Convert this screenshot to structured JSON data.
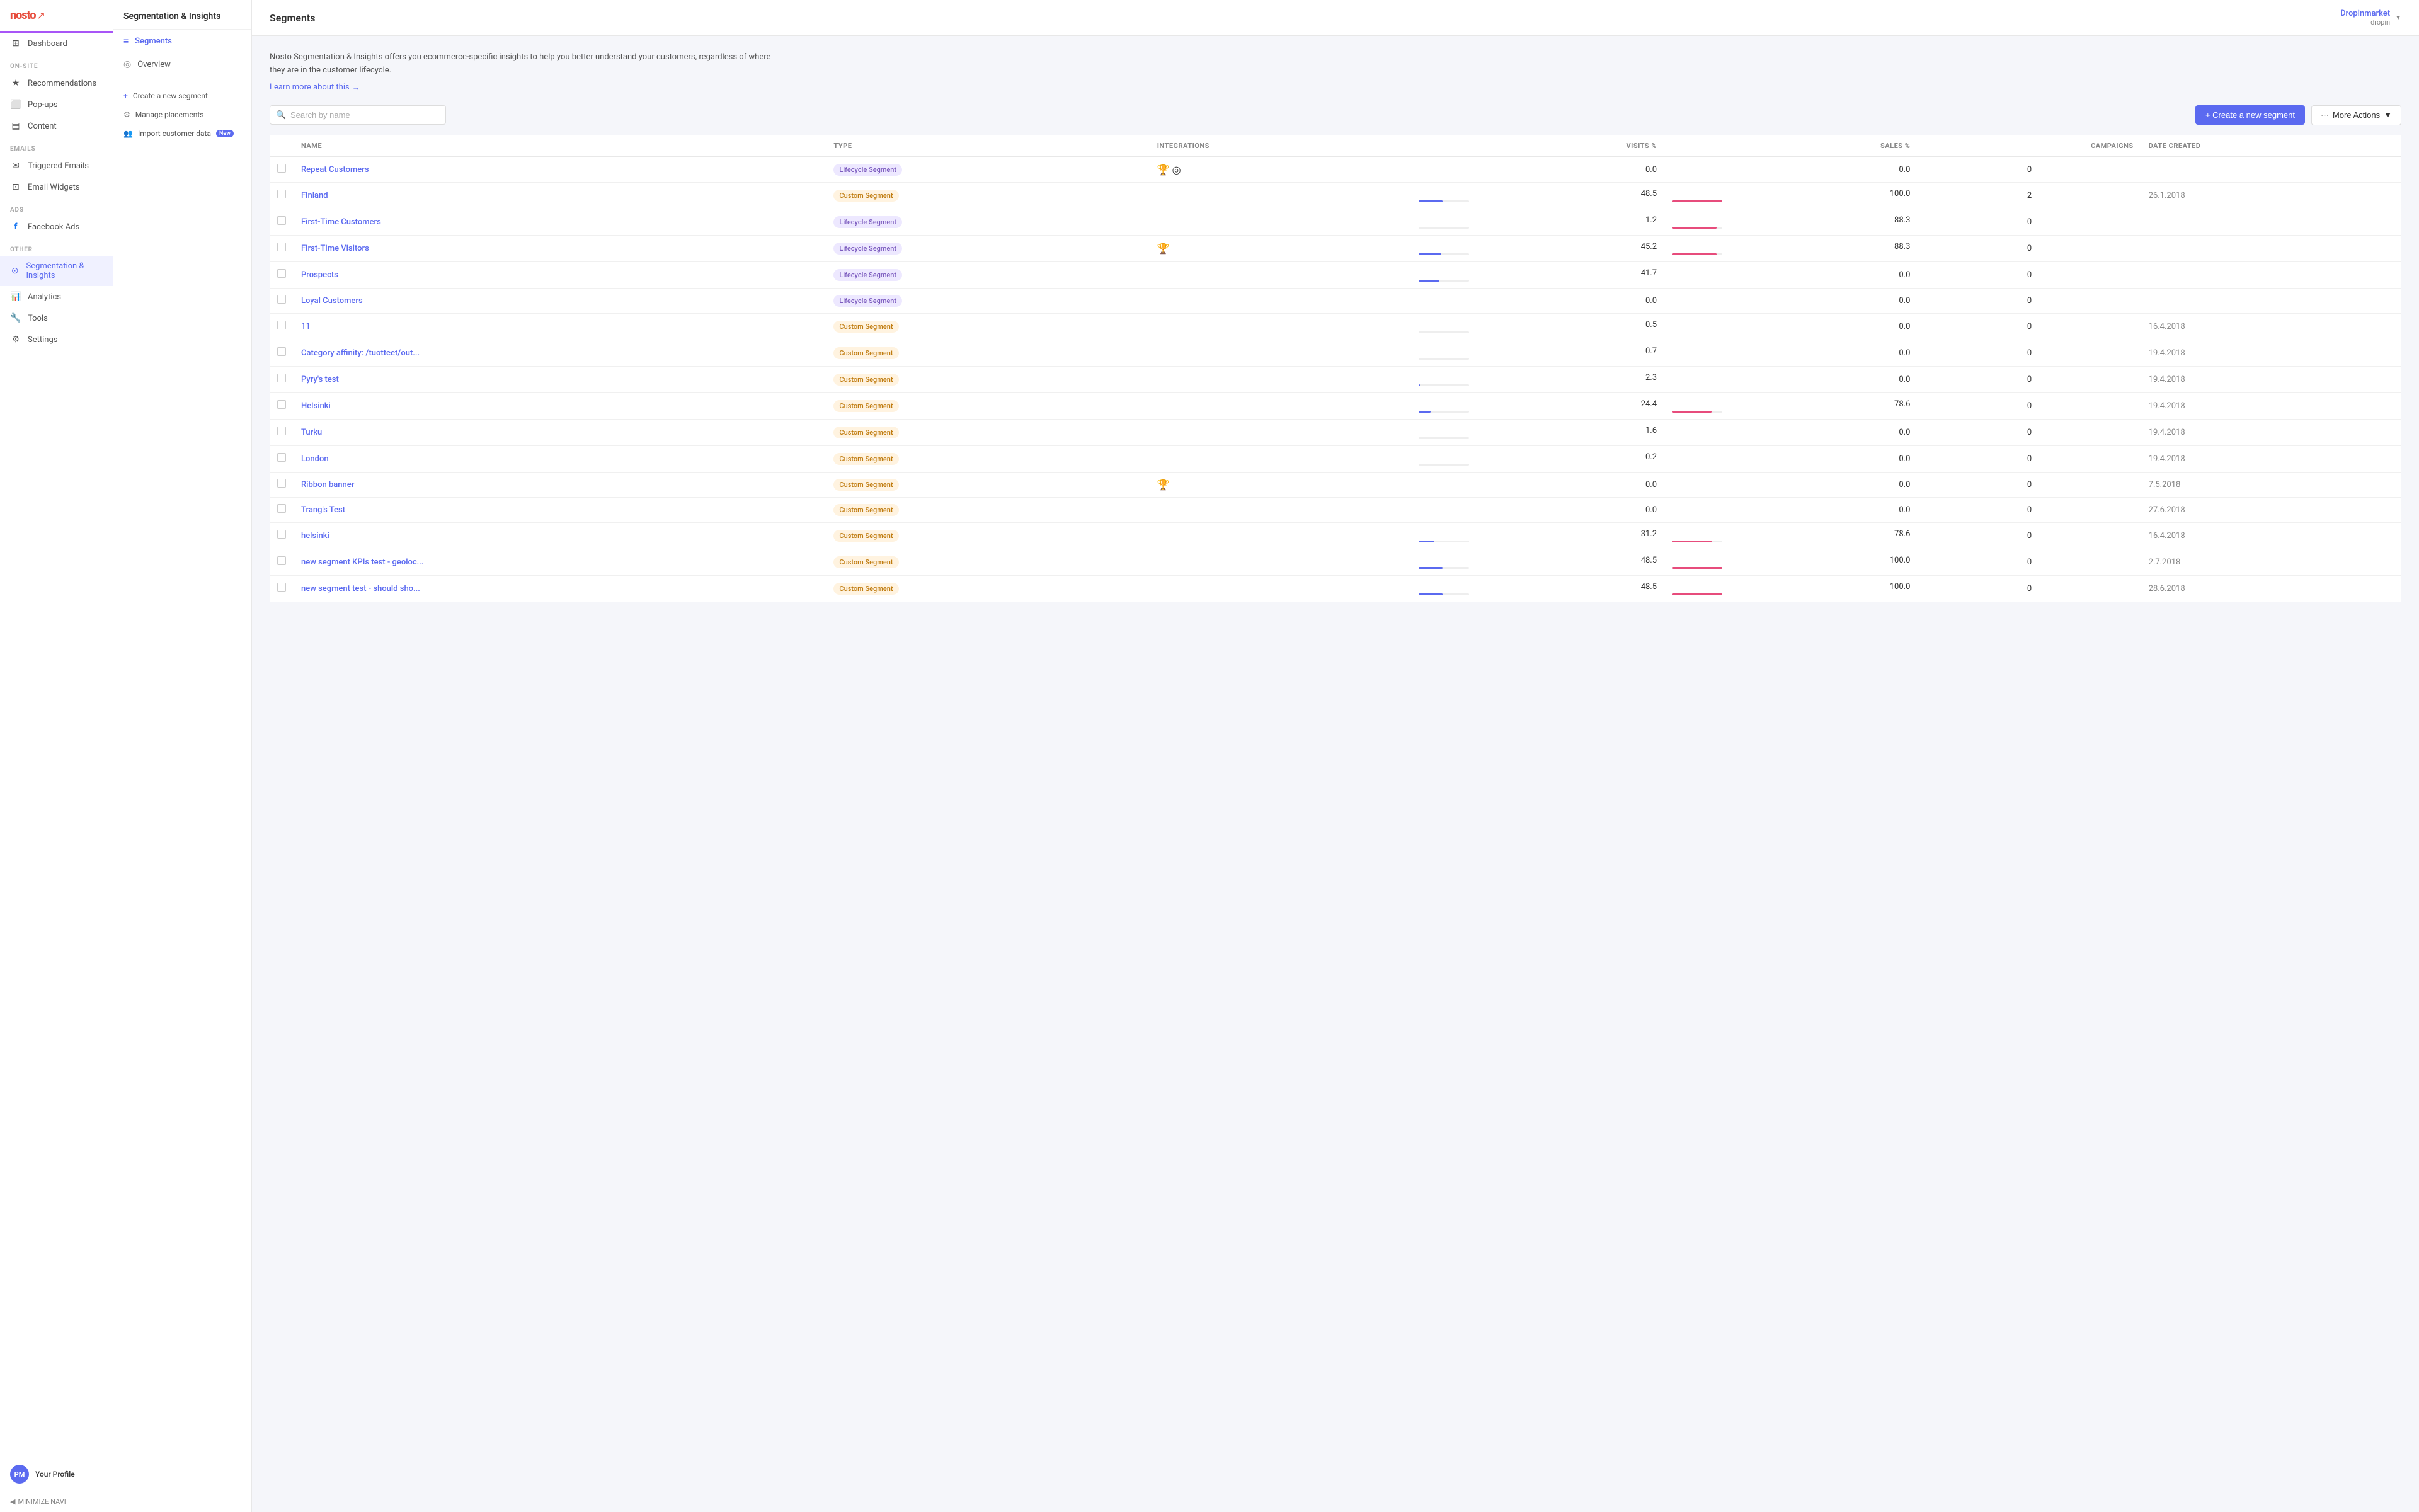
{
  "app": {
    "logo_text": "nosto",
    "logo_symbol": "↗"
  },
  "sidebar": {
    "sections": [
      {
        "label": "",
        "items": [
          {
            "id": "dashboard",
            "label": "Dashboard",
            "icon": "⊞"
          }
        ]
      },
      {
        "label": "ON-SITE",
        "items": [
          {
            "id": "recommendations",
            "label": "Recommendations",
            "icon": "★"
          },
          {
            "id": "popups",
            "label": "Pop-ups",
            "icon": "⬜"
          },
          {
            "id": "content",
            "label": "Content",
            "icon": "▤"
          }
        ]
      },
      {
        "label": "EMAILS",
        "items": [
          {
            "id": "triggered-emails",
            "label": "Triggered Emails",
            "icon": "✉"
          },
          {
            "id": "email-widgets",
            "label": "Email Widgets",
            "icon": "⊡"
          }
        ]
      },
      {
        "label": "ADS",
        "items": [
          {
            "id": "facebook-ads",
            "label": "Facebook Ads",
            "icon": "f"
          }
        ]
      },
      {
        "label": "OTHER",
        "items": [
          {
            "id": "segmentation",
            "label": "Segmentation & Insights",
            "icon": "⊙",
            "active": true
          },
          {
            "id": "analytics",
            "label": "Analytics",
            "icon": "📊"
          },
          {
            "id": "tools",
            "label": "Tools",
            "icon": "🔧"
          },
          {
            "id": "settings",
            "label": "Settings",
            "icon": "⚙"
          }
        ]
      }
    ],
    "profile": {
      "initials": "PM",
      "name": "Your Profile"
    },
    "minimize_label": "MINIMIZE NAVI"
  },
  "middle_nav": {
    "title": "Segmentation & Insights",
    "items": [
      {
        "id": "segments",
        "label": "Segments",
        "icon": "≡",
        "active": true
      },
      {
        "id": "overview",
        "label": "Overview",
        "icon": "◎"
      }
    ],
    "actions": [
      {
        "id": "create-segment",
        "label": "Create a new segment",
        "icon": "+"
      },
      {
        "id": "manage-placements",
        "label": "Manage placements",
        "icon": "⚙"
      },
      {
        "id": "import-customer",
        "label": "Import customer data",
        "icon": "👥",
        "badge": "New"
      }
    ]
  },
  "header": {
    "title": "Segments",
    "store": {
      "name": "Dropinmarket",
      "sub": "dropin"
    }
  },
  "description": {
    "text": "Nosto Segmentation & Insights offers you ecommerce-specific insights to help you better understand your customers, regardless of where they are in the customer lifecycle.",
    "learn_more": "Learn more about this"
  },
  "toolbar": {
    "search_placeholder": "Search by name",
    "create_button": "+ Create a new segment",
    "more_actions": "More Actions"
  },
  "table": {
    "columns": [
      "",
      "NAME",
      "TYPE",
      "INTEGRATIONS",
      "VISITS %",
      "SALES %",
      "CAMPAIGNS",
      "DATE CREATED"
    ],
    "rows": [
      {
        "name": "Repeat Customers",
        "type": "Lifecycle Segment",
        "type_class": "lifecycle",
        "integrations": [
          "🏆",
          "◎"
        ],
        "visits": "0.0",
        "visits_bar": 0,
        "sales": "0.0",
        "sales_bar": 0,
        "campaigns": "0",
        "date": ""
      },
      {
        "name": "Finland",
        "type": "Custom Segment",
        "type_class": "custom",
        "integrations": [],
        "visits": "48.5",
        "visits_bar": 48.5,
        "sales": "100.0",
        "sales_bar": 100,
        "campaigns": "2",
        "date": "26.1.2018",
        "has_actions": true
      },
      {
        "name": "First-Time Customers",
        "type": "Lifecycle Segment",
        "type_class": "lifecycle",
        "integrations": [],
        "visits": "1.2",
        "visits_bar": 1.2,
        "sales": "88.3",
        "sales_bar": 88.3,
        "campaigns": "0",
        "date": ""
      },
      {
        "name": "First-Time Visitors",
        "type": "Lifecycle Segment",
        "type_class": "lifecycle",
        "integrations": [
          "🏆"
        ],
        "visits": "45.2",
        "visits_bar": 45.2,
        "sales": "88.3",
        "sales_bar": 88.3,
        "campaigns": "0",
        "date": ""
      },
      {
        "name": "Prospects",
        "type": "Lifecycle Segment",
        "type_class": "lifecycle",
        "integrations": [],
        "visits": "41.7",
        "visits_bar": 41.7,
        "sales": "0.0",
        "sales_bar": 0,
        "campaigns": "0",
        "date": ""
      },
      {
        "name": "Loyal Customers",
        "type": "Lifecycle Segment",
        "type_class": "lifecycle",
        "integrations": [],
        "visits": "0.0",
        "visits_bar": 0,
        "sales": "0.0",
        "sales_bar": 0,
        "campaigns": "0",
        "date": ""
      },
      {
        "name": "11",
        "type": "Custom Segment",
        "type_class": "custom",
        "integrations": [],
        "visits": "0.5",
        "visits_bar": 0.5,
        "sales": "0.0",
        "sales_bar": 0,
        "campaigns": "0",
        "date": "16.4.2018"
      },
      {
        "name": "Category affinity: /tuotteet/out...",
        "type": "Custom Segment",
        "type_class": "custom",
        "integrations": [],
        "visits": "0.7",
        "visits_bar": 0.7,
        "sales": "0.0",
        "sales_bar": 0,
        "campaigns": "0",
        "date": "19.4.2018"
      },
      {
        "name": "Pyry's test",
        "type": "Custom Segment",
        "type_class": "custom",
        "integrations": [],
        "visits": "2.3",
        "visits_bar": 2.3,
        "sales": "0.0",
        "sales_bar": 0,
        "campaigns": "0",
        "date": "19.4.2018"
      },
      {
        "name": "Helsinki",
        "type": "Custom Segment",
        "type_class": "custom",
        "integrations": [],
        "visits": "24.4",
        "visits_bar": 24.4,
        "sales": "78.6",
        "sales_bar": 78.6,
        "campaigns": "0",
        "date": "19.4.2018"
      },
      {
        "name": "Turku",
        "type": "Custom Segment",
        "type_class": "custom",
        "integrations": [],
        "visits": "1.6",
        "visits_bar": 1.6,
        "sales": "0.0",
        "sales_bar": 0,
        "campaigns": "0",
        "date": "19.4.2018"
      },
      {
        "name": "London",
        "type": "Custom Segment",
        "type_class": "custom",
        "integrations": [],
        "visits": "0.2",
        "visits_bar": 0.2,
        "sales": "0.0",
        "sales_bar": 0,
        "campaigns": "0",
        "date": "19.4.2018"
      },
      {
        "name": "Ribbon banner",
        "type": "Custom Segment",
        "type_class": "custom",
        "integrations": [
          "🏆"
        ],
        "visits": "0.0",
        "visits_bar": 0,
        "sales": "0.0",
        "sales_bar": 0,
        "campaigns": "0",
        "date": "7.5.2018"
      },
      {
        "name": "Trang's Test",
        "type": "Custom Segment",
        "type_class": "custom",
        "integrations": [],
        "visits": "0.0",
        "visits_bar": 0,
        "sales": "0.0",
        "sales_bar": 0,
        "campaigns": "0",
        "date": "27.6.2018"
      },
      {
        "name": "helsinki",
        "type": "Custom Segment",
        "type_class": "custom",
        "integrations": [],
        "visits": "31.2",
        "visits_bar": 31.2,
        "sales": "78.6",
        "sales_bar": 78.6,
        "campaigns": "0",
        "date": "16.4.2018"
      },
      {
        "name": "new segment KPIs test - geoloc...",
        "type": "Custom Segment",
        "type_class": "custom",
        "integrations": [],
        "visits": "48.5",
        "visits_bar": 48.5,
        "sales": "100.0",
        "sales_bar": 100,
        "campaigns": "0",
        "date": "2.7.2018"
      },
      {
        "name": "new segment test - should sho...",
        "type": "Custom Segment",
        "type_class": "custom",
        "integrations": [],
        "visits": "48.5",
        "visits_bar": 48.5,
        "sales": "100.0",
        "sales_bar": 100,
        "campaigns": "0",
        "date": "28.6.2018"
      }
    ]
  }
}
